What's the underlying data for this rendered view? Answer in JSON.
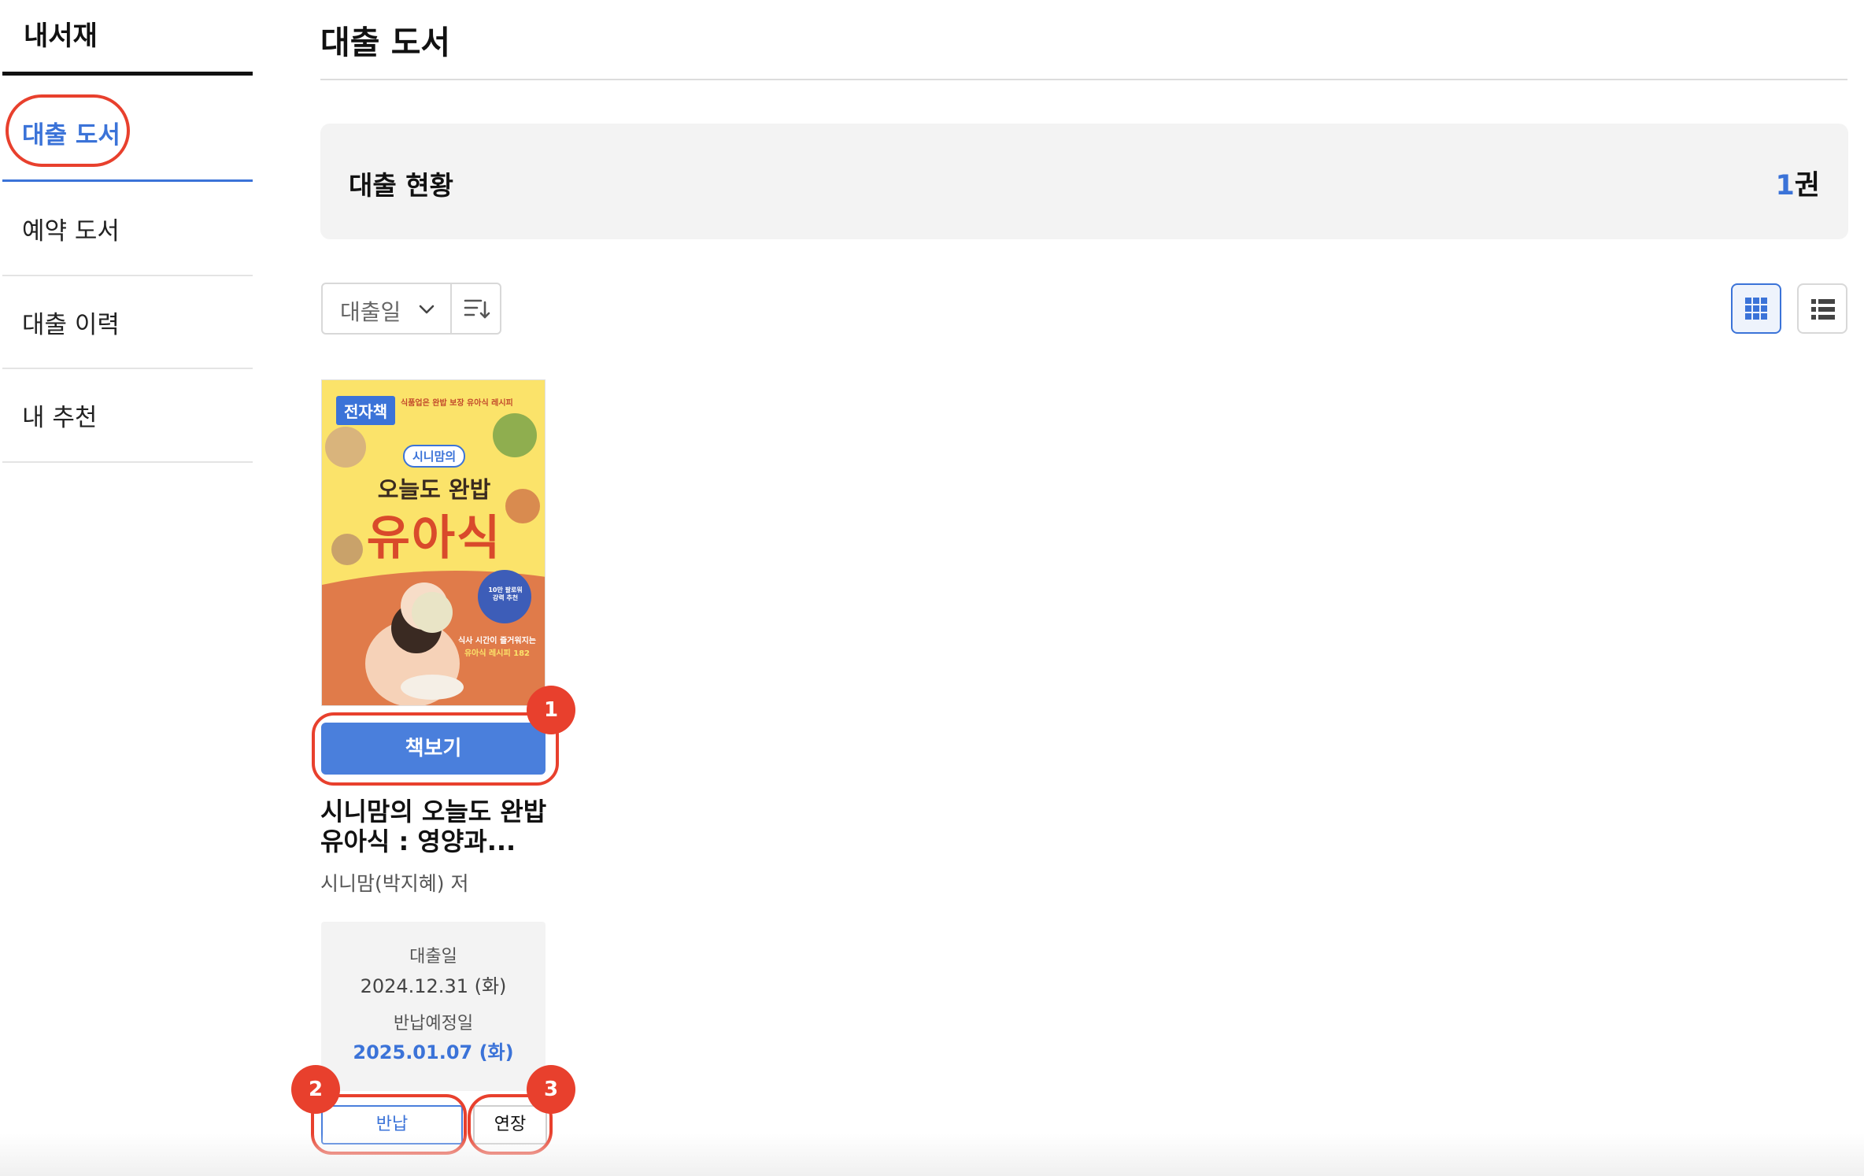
{
  "sidebar": {
    "title": "내서재",
    "items": [
      {
        "label": "대출 도서",
        "active": true
      },
      {
        "label": "예약 도서",
        "active": false
      },
      {
        "label": "대출 이력",
        "active": false
      },
      {
        "label": "내 추천",
        "active": false
      }
    ]
  },
  "main": {
    "page_title": "대출 도서",
    "status": {
      "label": "대출 현황",
      "count": "1",
      "unit": "권"
    },
    "sort": {
      "selected": "대출일"
    },
    "view_modes": {
      "grid": "grid-view-icon",
      "list": "list-view-icon",
      "active": "grid"
    }
  },
  "book": {
    "cover": {
      "badge": "전자책",
      "tagline": "식품업은 완밥 보장 유아식 레시피",
      "series": "시니맘의",
      "headline_top": "오늘도 완밥",
      "headline_main": "유아식",
      "sticker": "10만 팔로워 강력 추천",
      "sub_line_1": "식사 시간이 즐거워지는",
      "sub_line_2": "유아식 레시피 182"
    },
    "read_label": "책보기",
    "title_line_1": "시니맘의 오늘도 완밥",
    "title_line_2": "유아식 : 영양과...",
    "author": "시니맘(박지혜) 저",
    "loan_date_label": "대출일",
    "loan_date": "2024.12.31 (화)",
    "due_date_label": "반납예정일",
    "due_date": "2025.01.07 (화)",
    "return_label": "반납",
    "extend_label": "연장"
  },
  "annotations": [
    "1",
    "2",
    "3"
  ],
  "colors": {
    "accent": "#3b73d8",
    "button": "#4a7fdc",
    "annotation": "#e8402d",
    "panel": "#f3f3f3"
  }
}
